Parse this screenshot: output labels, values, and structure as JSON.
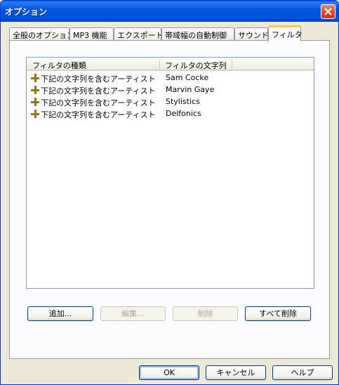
{
  "window": {
    "title": "オプション"
  },
  "tabs": [
    {
      "label": "全般のオプション"
    },
    {
      "label": "MP3 機能"
    },
    {
      "label": "エクスポート"
    },
    {
      "label": "帯域幅の自動制御"
    },
    {
      "label": "サウンド"
    },
    {
      "label": "フィルタ"
    }
  ],
  "filters": {
    "columns": [
      "フィルタの種類",
      "フィルタの文字列"
    ],
    "rows": [
      {
        "type": "下記の文字列を含むアーティスト",
        "value": "Sam Cocke"
      },
      {
        "type": "下記の文字列を含むアーティスト",
        "value": "Marvin Gaye"
      },
      {
        "type": "下記の文字列を含むアーティスト",
        "value": "Stylistics"
      },
      {
        "type": "下記の文字列を含むアーティスト",
        "value": "Delfonics"
      }
    ],
    "buttons": {
      "add": "追加...",
      "edit": "編集...",
      "delete": "削除",
      "delete_all": "すべて削除"
    }
  },
  "dialog_buttons": {
    "ok": "OK",
    "cancel": "キャンセル",
    "help": "ヘルプ"
  },
  "colors": {
    "titlebar": "#0356e0",
    "tab_highlight": "#ffc83c",
    "row_icon": "#8a7a1a"
  },
  "icons": {
    "close": "close-icon",
    "row": "plus-icon"
  }
}
